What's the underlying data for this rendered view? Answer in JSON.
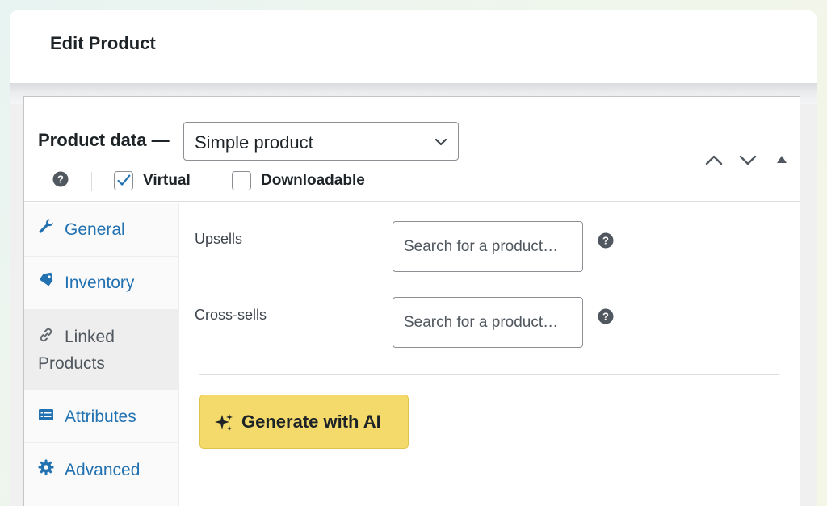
{
  "page": {
    "title": "Edit Product"
  },
  "product_data": {
    "label": "Product data —",
    "type_select": {
      "value": "Simple product"
    },
    "virtual": {
      "label": "Virtual",
      "checked": true
    },
    "downloadable": {
      "label": "Downloadable",
      "checked": false
    },
    "controls": [
      "chevron-up-icon",
      "chevron-down-icon",
      "triangle-up-icon"
    ]
  },
  "tabs": [
    {
      "label": "General",
      "icon": "wrench-icon",
      "active": false
    },
    {
      "label": "Inventory",
      "icon": "tag-icon",
      "active": false
    },
    {
      "label": "Linked Products",
      "icon": "link-icon",
      "active": true
    },
    {
      "label": "Attributes",
      "icon": "list-icon",
      "active": false
    },
    {
      "label": "Advanced",
      "icon": "gear-icon",
      "active": false
    }
  ],
  "linked": {
    "upsells": {
      "label": "Upsells",
      "placeholder": "Search for a product…"
    },
    "crosssells": {
      "label": "Cross-sells",
      "placeholder": "Search for a product…"
    }
  },
  "ai_button": {
    "label": "Generate with AI",
    "icon": "sparkle-icon"
  },
  "colors": {
    "accent_link": "#2271b1",
    "ai_button": "#f4da6a",
    "checkbox_check": "#2271b1"
  }
}
